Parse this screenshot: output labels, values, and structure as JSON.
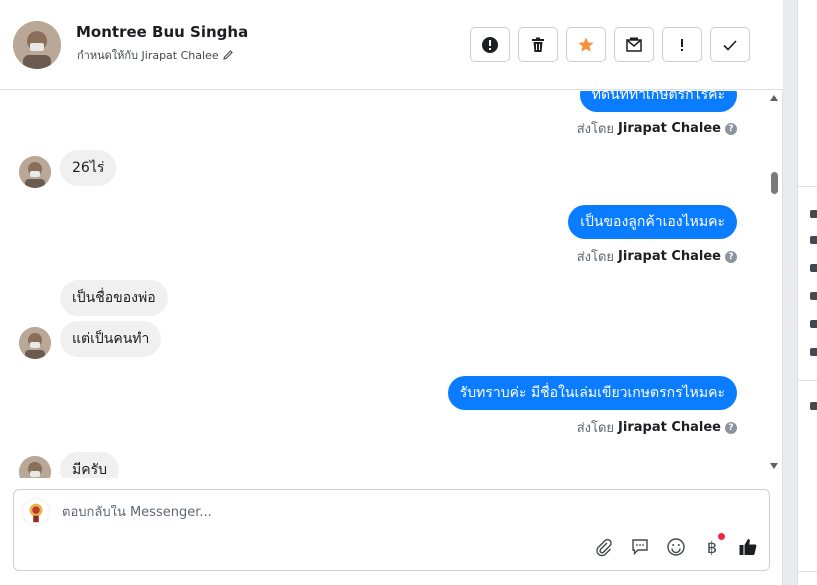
{
  "header": {
    "contact_name": "Montree Buu Singha",
    "assign_label": "กำหนดให้กับ Jirapat Chalee",
    "actions": [
      {
        "name": "mark-spam-button",
        "icon": "alert-circle-icon"
      },
      {
        "name": "delete-button",
        "icon": "trash-icon"
      },
      {
        "name": "star-button",
        "icon": "star-icon"
      },
      {
        "name": "mark-unread-button",
        "icon": "envelope-icon"
      },
      {
        "name": "follow-up-button",
        "icon": "exclamation-icon"
      },
      {
        "name": "mark-done-button",
        "icon": "check-icon"
      }
    ],
    "star_color": "#f7923b"
  },
  "messages": [
    {
      "side": "right",
      "text": "ที่ดินที่ทำเกษตรกี่ไร่คะ"
    },
    {
      "side": "meta",
      "prefix": "ส่งโดย",
      "agent": "Jirapat Chalee"
    },
    {
      "side": "left",
      "text": "26ไร่"
    },
    {
      "side": "right",
      "text": "เป็นของลูกค้าเองไหมคะ"
    },
    {
      "side": "meta",
      "prefix": "ส่งโดย",
      "agent": "Jirapat Chalee"
    },
    {
      "side": "left",
      "text": "เป็นชื่อของพ่อ"
    },
    {
      "side": "left",
      "text": "แต่เป็นคนทำ"
    },
    {
      "side": "right",
      "text": "รับทราบค่ะ มีชื่อในเล่มเขียวเกษตรกรไหมคะ"
    },
    {
      "side": "meta",
      "prefix": "ส่งโดย",
      "agent": "Jirapat Chalee"
    },
    {
      "side": "left",
      "text": "มีครับ"
    }
  ],
  "composer": {
    "placeholder": "ตอบกลับใน Messenger...",
    "tools": [
      "attachment-icon",
      "saved-reply-icon",
      "emoji-icon",
      "baht-payment-icon",
      "thumbs-up-icon"
    ],
    "baht_symbol": "฿"
  },
  "colors": {
    "outgoing_bubble": "#0a7cff",
    "incoming_bubble": "#f0f0f0",
    "notification_dot": "#f02849"
  }
}
